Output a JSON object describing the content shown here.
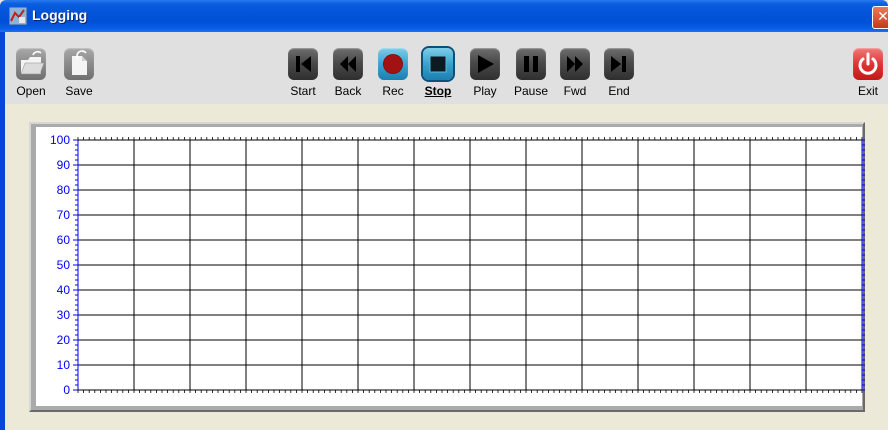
{
  "window": {
    "title": "Logging",
    "close_glyph": "✕"
  },
  "toolbar": {
    "open_label": "Open",
    "save_label": "Save",
    "start_label": "Start",
    "back_label": "Back",
    "rec_label": "Rec",
    "stop_label": "Stop",
    "play_label": "Play",
    "pause_label": "Pause",
    "fwd_label": "Fwd",
    "end_label": "End",
    "exit_label": "Exit",
    "active_button": "Stop"
  },
  "chart_data": {
    "type": "line",
    "title": "",
    "xlabel": "",
    "ylabel": "",
    "ylim": [
      0,
      100
    ],
    "y_ticks": [
      "100",
      "90",
      "80",
      "70",
      "60",
      "50",
      "40",
      "30",
      "20",
      "10",
      "0"
    ],
    "x_tick_labels": [],
    "grid": true,
    "series": []
  },
  "colors": {
    "title_bar": "#0454d8",
    "toolbar_bg": "#e0e0e0",
    "window_bg": "#ece9d8",
    "axis_label": "#0000ff",
    "grid": "#000000",
    "rec_accent": "#b01818",
    "exit_accent": "#e03535"
  }
}
